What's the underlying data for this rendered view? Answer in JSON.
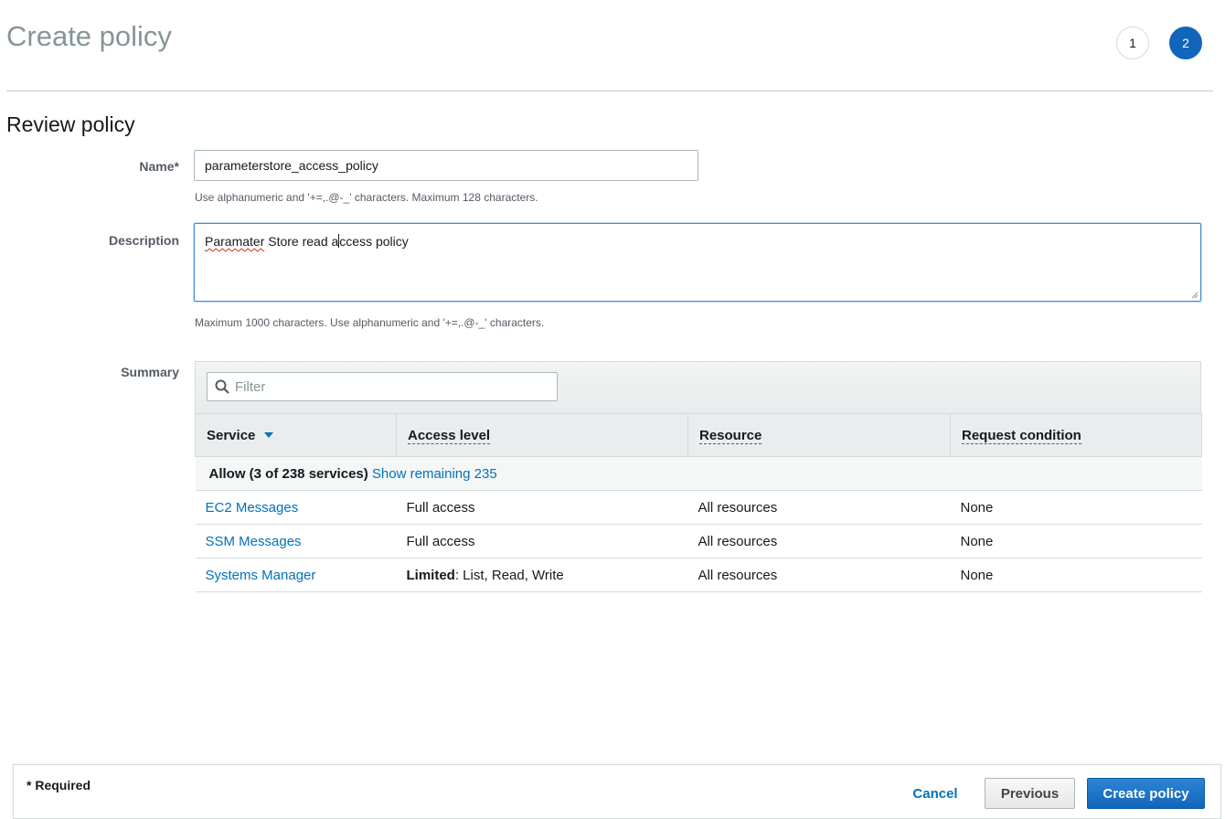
{
  "header": {
    "title": "Create policy",
    "steps": [
      "1",
      "2"
    ],
    "active_step": "2"
  },
  "section_title": "Review policy",
  "form": {
    "name_label": "Name*",
    "name_value": "parameterstore_access_policy",
    "name_hint": "Use alphanumeric and '+=,.@-_' characters. Maximum 128 characters.",
    "description_label": "Description",
    "description_value_misspelled": "Paramater",
    "description_value_a": " Store read a",
    "description_value_b": "ccess policy",
    "description_hint": "Maximum 1000 characters. Use alphanumeric and '+=,.@-_' characters.",
    "summary_label": "Summary"
  },
  "summary": {
    "filter_placeholder": "Filter",
    "columns": [
      "Service",
      "Access level",
      "Resource",
      "Request condition"
    ],
    "allow_label": "Allow (3 of 238 services)",
    "show_remaining": "Show remaining 235",
    "rows": [
      {
        "service": "EC2 Messages",
        "access_bold": "",
        "access": "Full access",
        "resource": "All resources",
        "condition": "None"
      },
      {
        "service": "SSM Messages",
        "access_bold": "",
        "access": "Full access",
        "resource": "All resources",
        "condition": "None"
      },
      {
        "service": "Systems Manager",
        "access_bold": "Limited",
        "access": ": List, Read, Write",
        "resource": "All resources",
        "condition": "None"
      }
    ]
  },
  "footer": {
    "required_note": "* Required",
    "cancel": "Cancel",
    "previous": "Previous",
    "create": "Create policy"
  },
  "colors": {
    "accent": "#1166bb",
    "link": "#0073bb"
  }
}
